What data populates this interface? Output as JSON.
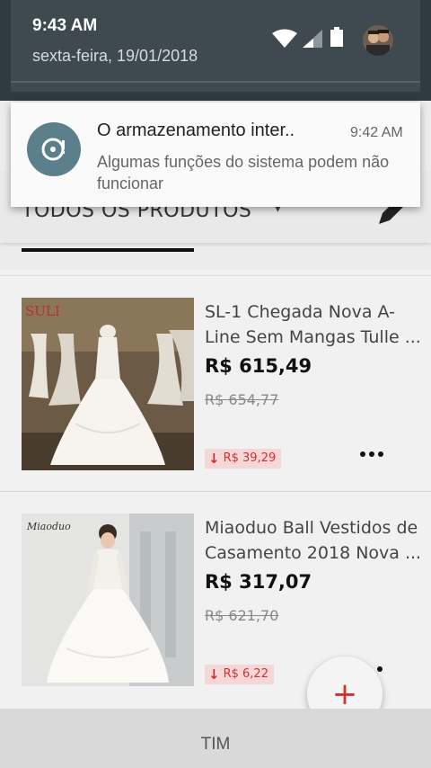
{
  "status_bar": {
    "time": "9:43 AM",
    "date": "sexta-feira, 19/01/2018",
    "icons": [
      "wifi-icon",
      "signal-icon",
      "battery-icon",
      "avatar"
    ]
  },
  "notification": {
    "icon": "storage-disc-icon",
    "title": "O armazenamento inter..",
    "time": "9:42 AM",
    "text": "Algumas funções do sistema podem não funcionar"
  },
  "app": {
    "category_label": "TODOS OS PRODUTOS",
    "products": [
      {
        "title_line1": "SL-1 Chegada Nova A-",
        "title_line2": "Line Sem Mangas Tulle ...",
        "price": "R$ 615,49",
        "old_price": "R$ 654,77",
        "drop": "R$ 39,29",
        "brand_mark": "SULI"
      },
      {
        "title_line1": "Miaoduo Ball Vestidos de",
        "title_line2": "Casamento 2018 Nova ...",
        "price": "R$ 317,07",
        "old_price": "R$ 621,70",
        "drop": "R$ 6,22",
        "brand_mark": "Miaoduo"
      }
    ],
    "fab_label": "+"
  },
  "carrier": "TIM",
  "colors": {
    "accent_red": "#d32f2f",
    "shade_dark": "#2f3b41",
    "notification_icon_bg": "#5b808c"
  }
}
